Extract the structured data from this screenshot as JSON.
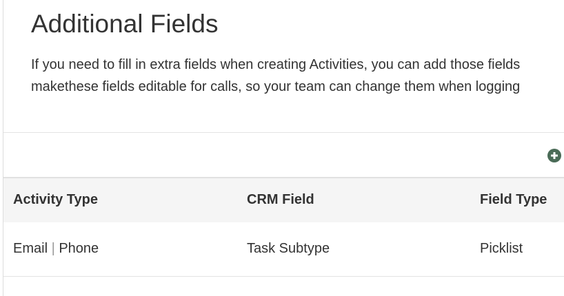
{
  "section": {
    "title": "Additional Fields",
    "description_line1": "If you need to fill in extra fields when creating Activities, you can add those fields",
    "description_line2": "makethese fields editable for calls, so your team can change them when logging"
  },
  "toolbar": {
    "add_icon": "plus-circle-icon",
    "add_icon_color": "#4a6b57"
  },
  "table": {
    "columns": [
      "Activity Type",
      "CRM Field",
      "Field Type"
    ],
    "rows": [
      {
        "activity_type_a": "Email",
        "activity_type_sep": "|",
        "activity_type_b": "Phone",
        "crm_field": "Task Subtype",
        "field_type": "Picklist"
      }
    ]
  }
}
